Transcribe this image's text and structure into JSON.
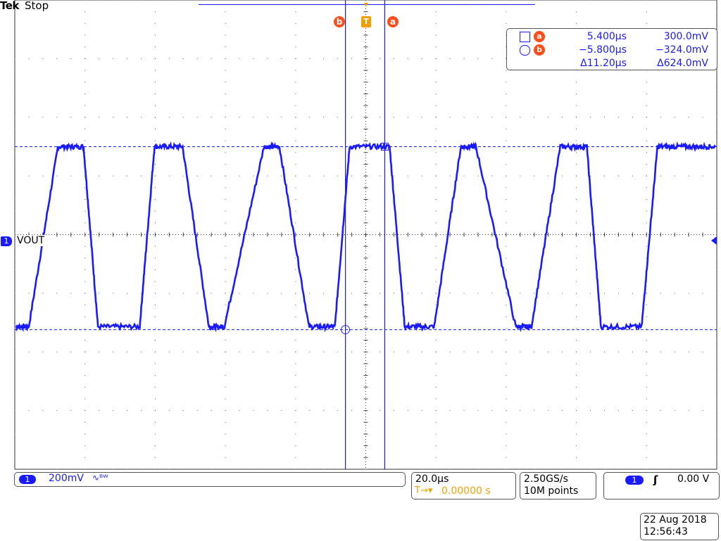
{
  "header": {
    "brand": "Tek",
    "status": "Stop"
  },
  "cursors": {
    "a_label": "a",
    "b_label": "b",
    "trigger_label": "T",
    "a": {
      "time": "5.400µs",
      "value": "300.0mV"
    },
    "b": {
      "time": "−5.800µs",
      "value": "−324.0mV"
    },
    "delta": {
      "time": "Δ11.20µs",
      "value": "Δ624.0mV"
    }
  },
  "channel": {
    "number": "1",
    "label": "VOUT",
    "scale": "200mV",
    "bw_symbol": "∿ᴮᵂ",
    "color": "#1a1aff"
  },
  "timebase": {
    "scale": "20.0µs",
    "trigger_position_prefix": "T→▾",
    "trigger_position": "0.00000 s"
  },
  "acquisition": {
    "sample_rate": "2.50GS/s",
    "record_length": "10M points"
  },
  "trigger": {
    "source": "1",
    "slope_symbol": "ʃ",
    "level": "0.00 V"
  },
  "datetime": {
    "date": "22 Aug 2018",
    "time": "12:56:43"
  },
  "chart_data": {
    "type": "line",
    "title": "",
    "xlabel": "",
    "ylabel": "",
    "x_unit": "µs",
    "y_unit": "mV",
    "xlim": [
      -100,
      100
    ],
    "ylim": [
      -800,
      800
    ],
    "grid": true,
    "series": [
      {
        "name": "VOUT",
        "x": [
          -99.6,
          -96.0,
          -87.7,
          -80.4,
          -76.3,
          -64.4,
          -60.2,
          -52.2,
          -44.7,
          -40.3,
          -29.0,
          -24.6,
          -16.2,
          -8.8,
          -4.6,
          6.8,
          11.1,
          19.5,
          27.1,
          31.4,
          42.7,
          47.2,
          55.4,
          63.0,
          67.0,
          78.6,
          83.1,
          91.2,
          99.6
        ],
        "y": [
          -314,
          -314,
          300,
          300,
          -314,
          -314,
          300,
          300,
          -314,
          -314,
          300,
          300,
          -314,
          -314,
          300,
          300,
          -314,
          -314,
          300,
          300,
          -314,
          -314,
          300,
          300,
          -314,
          -314,
          300,
          300,
          300
        ]
      }
    ]
  },
  "colors": {
    "trace": "#1a1aff",
    "cursor_tag": "#ff4c1a",
    "trigger": "#f0a000",
    "grid": "#555555"
  }
}
